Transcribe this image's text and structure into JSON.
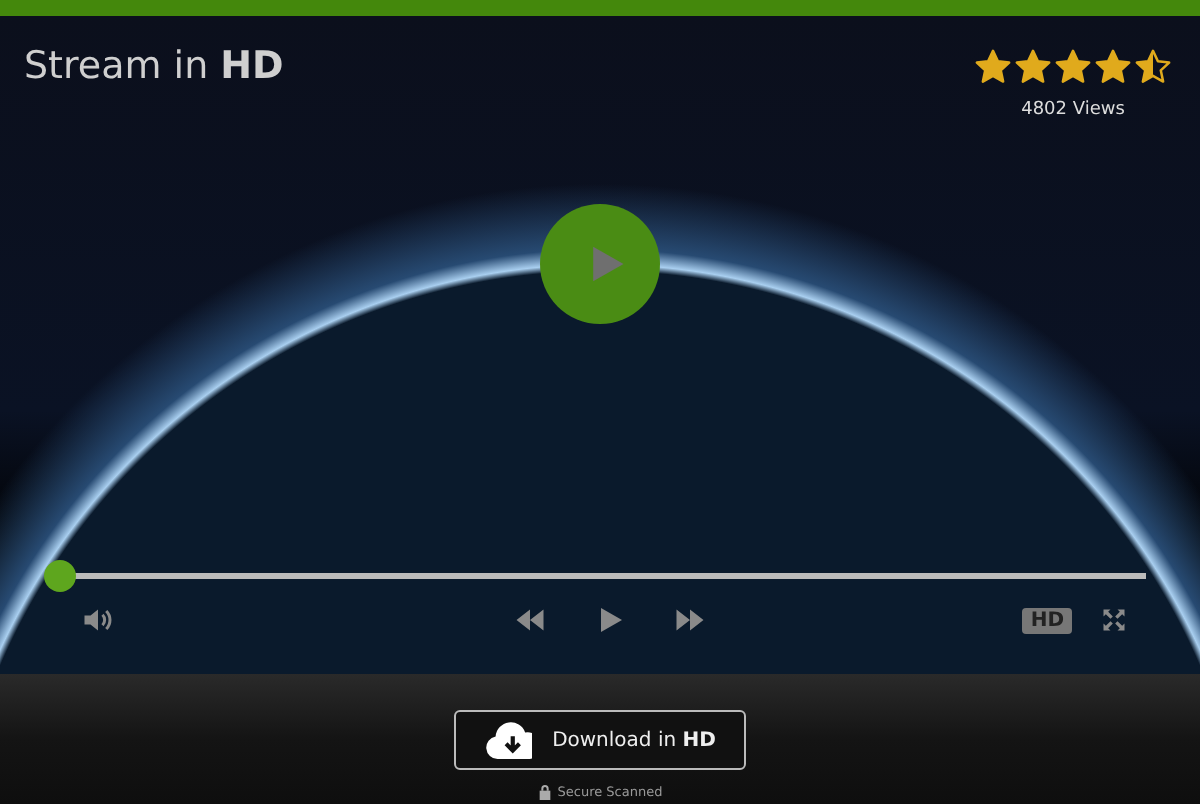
{
  "video": {
    "title": "Stream in **HD**",
    "rating": {
      "stars": 4.5
    },
    "views": "4802 Views",
    "progress": {
      "level": 0
    },
    "quality_badge": "HD"
  },
  "download_button": {
    "label": "Download in **HD**"
  },
  "secure_note": "Secure Scanned"
}
